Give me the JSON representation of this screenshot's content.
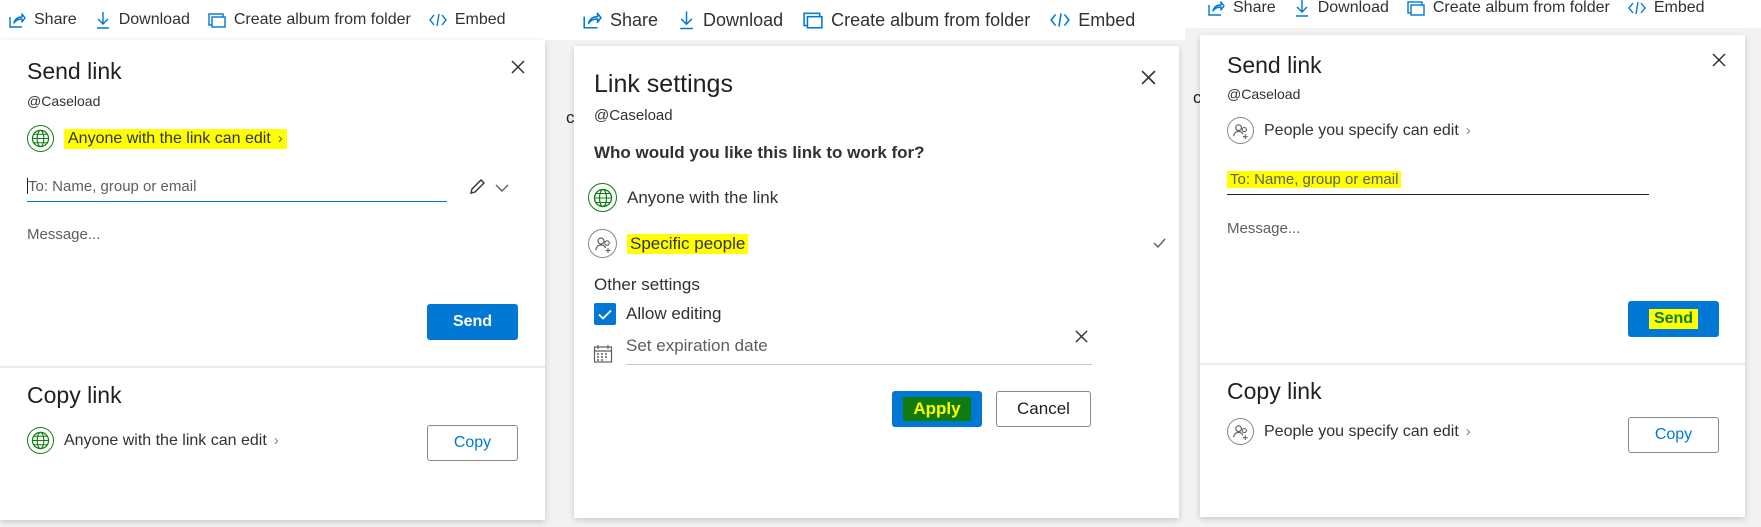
{
  "toolbar": {
    "share": "Share",
    "download": "Download",
    "create_album": "Create album from folder",
    "embed": "Embed"
  },
  "panel1": {
    "title": "Send link",
    "account": "@Caseload",
    "permission": "Anyone with the link can edit",
    "to_placeholder": "To: Name, group or email",
    "message_placeholder": "Message...",
    "send": "Send",
    "copy_title": "Copy link",
    "copy_permission": "Anyone with the link can edit",
    "copy": "Copy"
  },
  "panel2": {
    "title": "Link settings",
    "account": "@Caseload",
    "question": "Who would you like this link to work for?",
    "option_anyone": "Anyone with the link",
    "option_specific": "Specific people",
    "other_settings": "Other settings",
    "allow_editing": "Allow editing",
    "allow_editing_checked": true,
    "expiration_placeholder": "Set expiration date",
    "apply": "Apply",
    "cancel": "Cancel",
    "cut_text": "c"
  },
  "panel3": {
    "title": "Send link",
    "account": "@Caseload",
    "permission": "People you specify can edit",
    "to_placeholder": "To: Name, group or email",
    "message_placeholder": "Message...",
    "send": "Send",
    "copy_title": "Copy link",
    "copy_permission": "People you specify can edit",
    "copy": "Copy",
    "cut_text": "c"
  },
  "colors": {
    "accent": "#0078d4",
    "highlight": "#ffff00",
    "globe": "#107c10",
    "apply_text": "#ffff00"
  }
}
